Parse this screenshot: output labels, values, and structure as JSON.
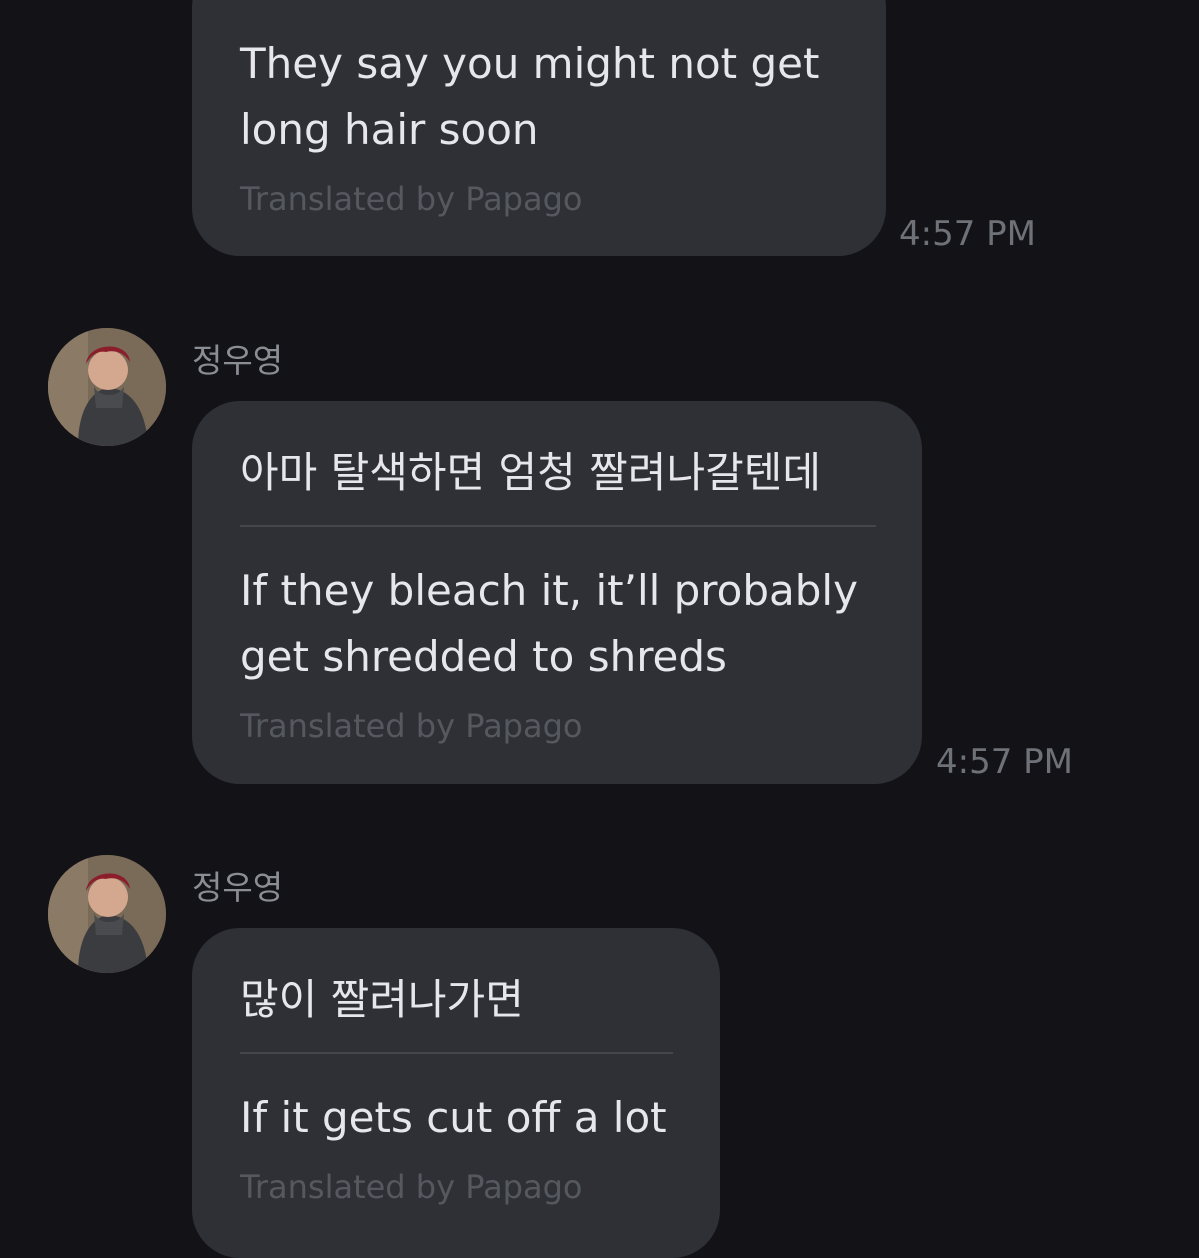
{
  "messages": [
    {
      "sender": "",
      "original": "",
      "translation_line1": "They say you might not get",
      "translation_line2": "long hair soon",
      "translated_by": "Translated by Papago",
      "time": "4:57 PM"
    },
    {
      "sender": "정우영",
      "original": "아마 탈색하면 엄청 짤려나갈텐데",
      "translation_line1": "If they bleach it, it’ll probably",
      "translation_line2": "get shredded to shreds",
      "translated_by": "Translated by Papago",
      "time": "4:57 PM"
    },
    {
      "sender": "정우영",
      "original": "많이 짤려나가면",
      "translation_line1": "If it gets cut off a lot",
      "translation_line2": "",
      "translated_by": "Translated by Papago",
      "time": ""
    }
  ],
  "colors": {
    "background": "#131317",
    "bubble": "#2e3036",
    "text": "#e6e6eb",
    "muted": "#55585f"
  }
}
